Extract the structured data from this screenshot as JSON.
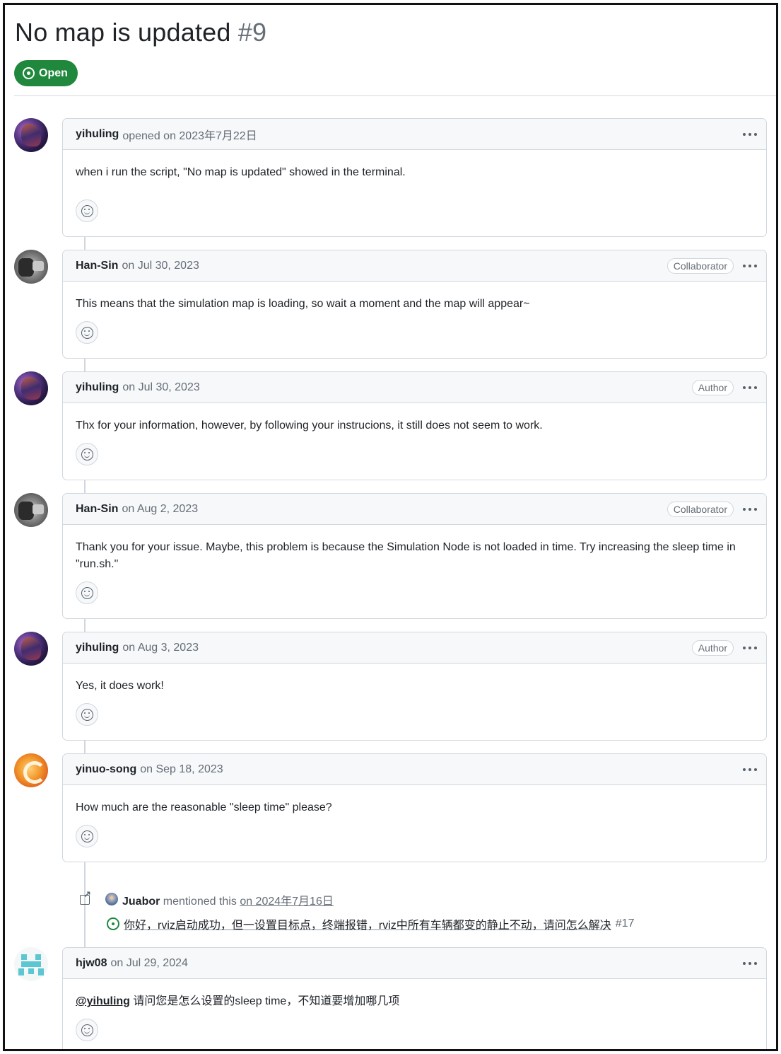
{
  "issue": {
    "title": "No map is updated",
    "number": "#9",
    "state": "Open",
    "state_color": "#1f883d"
  },
  "comments": [
    {
      "author": "yihuling",
      "meta": "opened on 2023年7月22日",
      "role": "",
      "body": "when i run the script, \"No map is updated\" showed in the terminal.",
      "avatar_icon": "avatar-yihuling"
    },
    {
      "author": "Han-Sin",
      "meta": "on Jul 30, 2023",
      "role": "Collaborator",
      "body": "This means that the simulation map is loading, so wait a moment and the map will appear~",
      "avatar_icon": "avatar-hansin"
    },
    {
      "author": "yihuling",
      "meta": "on Jul 30, 2023",
      "role": "Author",
      "body": "Thx for your information, however, by following your instrucions, it still does not seem to work.",
      "avatar_icon": "avatar-yihuling"
    },
    {
      "author": "Han-Sin",
      "meta": "on Aug 2, 2023",
      "role": "Collaborator",
      "body": "Thank you for your issue. Maybe, this problem is because the Simulation Node is not loaded in time. Try increasing the sleep time in \"run.sh.\"",
      "avatar_icon": "avatar-hansin"
    },
    {
      "author": "yihuling",
      "meta": "on Aug 3, 2023",
      "role": "Author",
      "body": "Yes, it does work!",
      "avatar_icon": "avatar-yihuling"
    },
    {
      "author": "yinuo-song",
      "meta": "on Sep 18, 2023",
      "role": "",
      "body": "How much are the reasonable \"sleep time\" please?",
      "avatar_icon": "avatar-yinuo"
    },
    {
      "author": "hjw08",
      "meta": "on Jul 29, 2024",
      "role": "",
      "mention": "@yihuling",
      "body": "请问您是怎么设置的sleep time，不知道要增加哪几项",
      "avatar_icon": "avatar-hjw"
    }
  ],
  "cross_reference": {
    "user": "Juabor",
    "action": "mentioned this",
    "date": "on 2024年7月16日",
    "issue_title": "你好，rviz启动成功，但一设置目标点，终端报错，rviz中所有车辆都变的静止不动，请问怎么解决",
    "issue_number": "#17"
  }
}
